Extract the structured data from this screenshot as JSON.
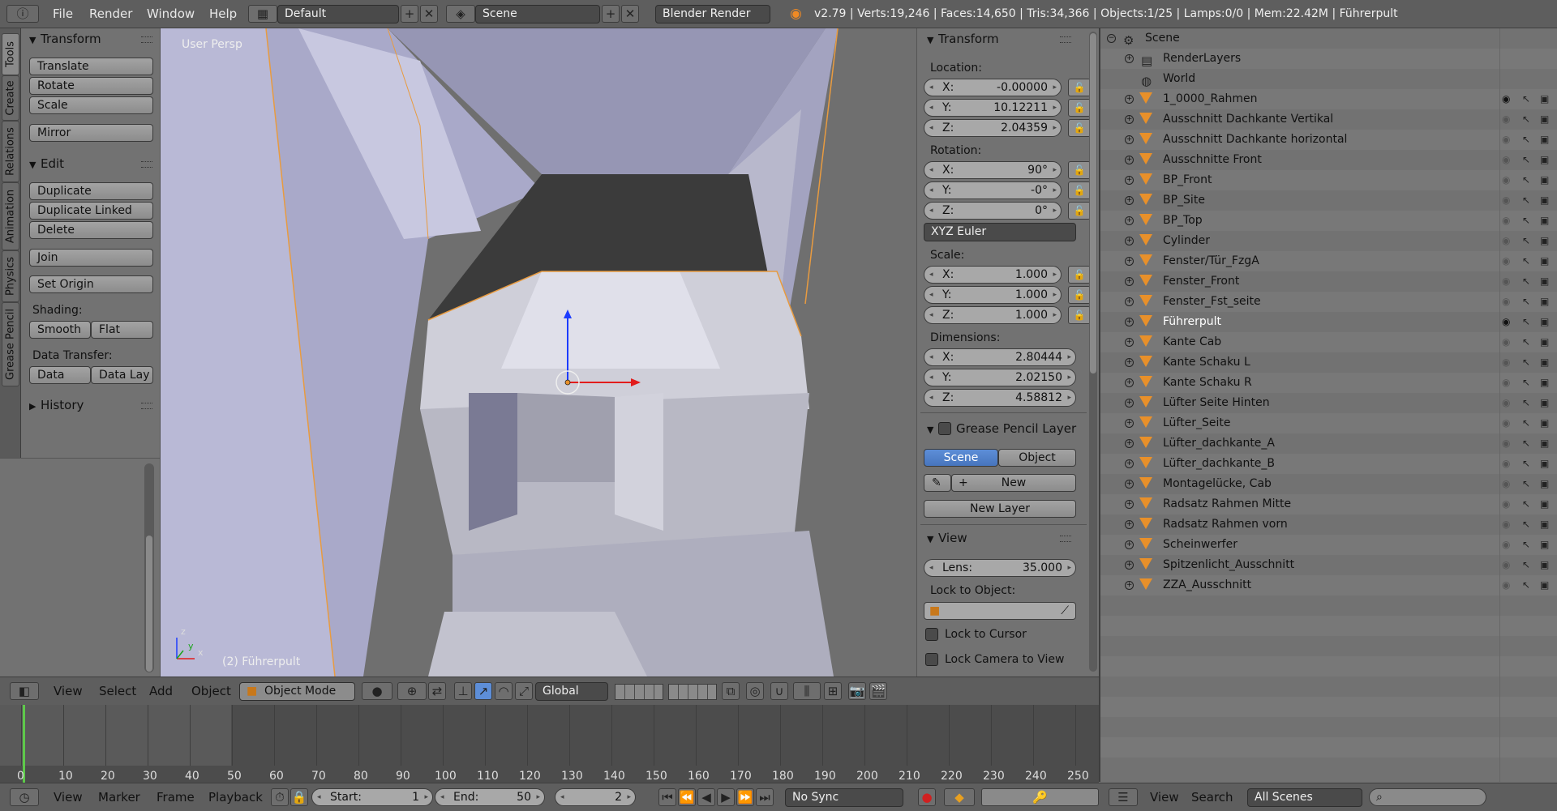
{
  "topbar": {
    "menus": [
      "File",
      "Render",
      "Window",
      "Help"
    ],
    "layout": "Default",
    "scene": "Scene",
    "engine": "Blender Render",
    "stats": "v2.79 | Verts:19,246 | Faces:14,650 | Tris:34,366 | Objects:1/25 | Lamps:0/0 | Mem:22.42M | Führerpult"
  },
  "vtabs": [
    "Tools",
    "Create",
    "Relations",
    "Animation",
    "Physics",
    "Grease Pencil"
  ],
  "tools": {
    "transform_title": "Transform",
    "translate": "Translate",
    "rotate": "Rotate",
    "scale": "Scale",
    "mirror": "Mirror",
    "edit_title": "Edit",
    "duplicate": "Duplicate",
    "duplicate_linked": "Duplicate Linked",
    "delete": "Delete",
    "join": "Join",
    "set_origin": "Set Origin",
    "shading_label": "Shading:",
    "smooth": "Smooth",
    "flat": "Flat",
    "data_transfer_label": "Data Transfer:",
    "data": "Data",
    "data_lay": "Data Lay",
    "history_title": "History"
  },
  "viewport": {
    "persp": "User Persp",
    "object_label": "(2) Führerpult",
    "axis_z": "z",
    "axis_y": "y",
    "axis_x": "x"
  },
  "props": {
    "transform_title": "Transform",
    "location_label": "Location:",
    "location": {
      "x": "-0.00000",
      "y": "10.12211",
      "z": "2.04359"
    },
    "rotation_label": "Rotation:",
    "rotation": {
      "x": "90°",
      "y": "-0°",
      "z": "0°"
    },
    "rotation_mode": "XYZ Euler",
    "scale_label": "Scale:",
    "scale": {
      "x": "1.000",
      "y": "1.000",
      "z": "1.000"
    },
    "dimensions_label": "Dimensions:",
    "dimensions": {
      "x": "2.80444",
      "y": "2.02150",
      "z": "4.58812"
    },
    "axis": {
      "x": "X:",
      "y": "Y:",
      "z": "Z:"
    },
    "gp_title": "Grease Pencil Layer",
    "gp_scene": "Scene",
    "gp_object": "Object",
    "gp_new": "New",
    "gp_new_layer": "New Layer",
    "view_title": "View",
    "lens_label": "Lens:",
    "lens": "35.000",
    "lock_object_label": "Lock to Object:",
    "lock_cursor": "Lock to Cursor",
    "lock_camera": "Lock Camera to View"
  },
  "vpheader": {
    "menus": [
      "View",
      "Select",
      "Add",
      "Object"
    ],
    "mode": "Object Mode",
    "orientation": "Global"
  },
  "timeline": {
    "ticks": [
      "0",
      "10",
      "20",
      "30",
      "40",
      "50",
      "60",
      "70",
      "80",
      "90",
      "100",
      "110",
      "120",
      "130",
      "140",
      "150",
      "160",
      "170",
      "180",
      "190",
      "200",
      "210",
      "220",
      "230",
      "240",
      "250"
    ],
    "current_frame_marker": 2
  },
  "tlbar": {
    "menus": [
      "View",
      "Marker",
      "Frame",
      "Playback"
    ],
    "start_label": "Start:",
    "start": "1",
    "end_label": "End:",
    "end": "50",
    "current": "2",
    "sync": "No Sync"
  },
  "outliner": {
    "items": [
      {
        "name": "Scene",
        "type": "scene"
      },
      {
        "name": "RenderLayers",
        "type": "renderlayers"
      },
      {
        "name": "World",
        "type": "world"
      },
      {
        "name": "1_0000_Rahmen",
        "type": "mesh",
        "visible": true
      },
      {
        "name": "Ausschnitt Dachkante Vertikal",
        "type": "mesh"
      },
      {
        "name": "Ausschnitt Dachkante horizontal",
        "type": "mesh"
      },
      {
        "name": "Ausschnitte Front",
        "type": "mesh"
      },
      {
        "name": "BP_Front",
        "type": "mesh"
      },
      {
        "name": "BP_Site",
        "type": "mesh"
      },
      {
        "name": "BP_Top",
        "type": "mesh"
      },
      {
        "name": "Cylinder",
        "type": "mesh"
      },
      {
        "name": "Fenster/Tür_FzgA",
        "type": "mesh"
      },
      {
        "name": "Fenster_Front",
        "type": "mesh"
      },
      {
        "name": "Fenster_Fst_seite",
        "type": "mesh"
      },
      {
        "name": "Führerpult",
        "type": "mesh",
        "visible": true,
        "selected": true
      },
      {
        "name": "Kante Cab",
        "type": "mesh"
      },
      {
        "name": "Kante Schaku L",
        "type": "mesh"
      },
      {
        "name": "Kante Schaku R",
        "type": "mesh"
      },
      {
        "name": "Lüfter Seite Hinten",
        "type": "mesh"
      },
      {
        "name": "Lüfter_Seite",
        "type": "mesh"
      },
      {
        "name": "Lüfter_dachkante_A",
        "type": "mesh"
      },
      {
        "name": "Lüfter_dachkante_B",
        "type": "mesh"
      },
      {
        "name": "Montagelücke, Cab",
        "type": "mesh"
      },
      {
        "name": "Radsatz Rahmen Mitte",
        "type": "mesh"
      },
      {
        "name": "Radsatz Rahmen vorn",
        "type": "mesh"
      },
      {
        "name": "Scheinwerfer",
        "type": "mesh"
      },
      {
        "name": "Spitzenlicht_Ausschnitt",
        "type": "mesh"
      },
      {
        "name": "ZZA_Ausschnitt",
        "type": "mesh"
      }
    ],
    "footer": {
      "menus": [
        "View",
        "Search"
      ],
      "scene_filter": "All Scenes"
    }
  },
  "colors": {
    "accent": "#4775bd",
    "object_orange": "#e8902a",
    "selection_outline": "#ff9d2e"
  }
}
